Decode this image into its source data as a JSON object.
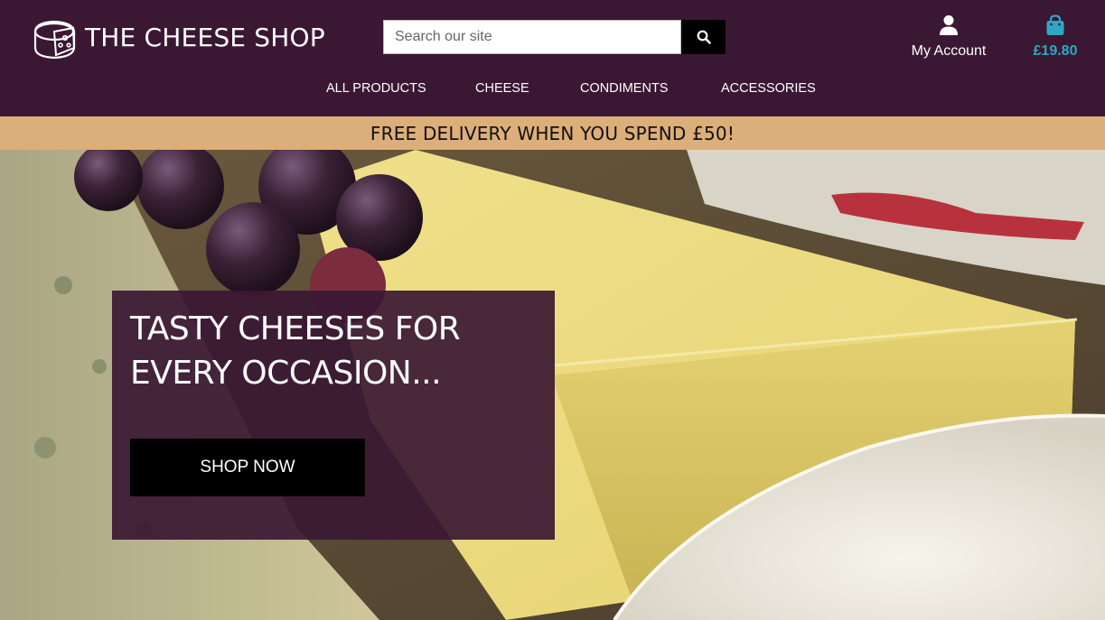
{
  "header": {
    "brand": "THE CHEESE SHOP",
    "search": {
      "placeholder": "Search our site"
    },
    "account_label": "My Account",
    "basket_total": "£19.80"
  },
  "nav": {
    "items": [
      {
        "label": "ALL PRODUCTS"
      },
      {
        "label": "CHEESE"
      },
      {
        "label": "CONDIMENTS"
      },
      {
        "label": "ACCESSORIES"
      }
    ]
  },
  "banner": {
    "text": "FREE DELIVERY WHEN YOU SPEND £50!"
  },
  "hero": {
    "title": "TASTY CHEESES FOR EVERY OCCASION...",
    "cta_label": "SHOP NOW"
  },
  "colors": {
    "header_bg": "#3a1833",
    "banner_bg": "#dcae7a",
    "basket_accent": "#2ea7c4",
    "button_bg": "#000000"
  },
  "icons": {
    "logo": "cheese-wheel-icon",
    "search": "search-icon",
    "account": "user-icon",
    "basket": "shopping-bag-icon"
  }
}
